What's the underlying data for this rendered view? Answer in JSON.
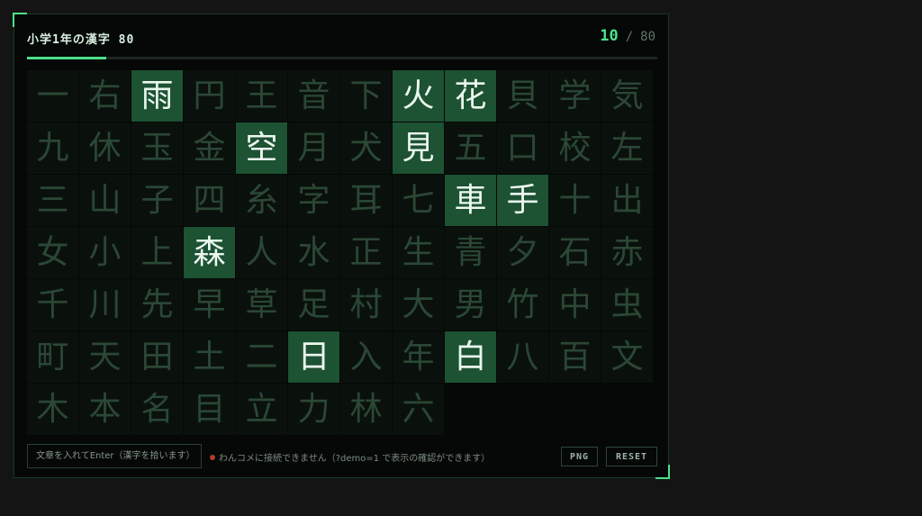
{
  "header": {
    "title": "小学1年の漢字 80",
    "count_current": "10",
    "count_separator": "/",
    "count_total": "80"
  },
  "progress": {
    "value": 0.125
  },
  "colors": {
    "accent": "#4ee08a",
    "found_cell": "#1d5233",
    "empty_cell": "#0a110c",
    "status_dot": "#b8392f"
  },
  "grid": {
    "columns": 12,
    "cells": [
      {
        "char": "一",
        "found": false
      },
      {
        "char": "右",
        "found": false
      },
      {
        "char": "雨",
        "found": true
      },
      {
        "char": "円",
        "found": false
      },
      {
        "char": "王",
        "found": false
      },
      {
        "char": "音",
        "found": false
      },
      {
        "char": "下",
        "found": false
      },
      {
        "char": "火",
        "found": true
      },
      {
        "char": "花",
        "found": true
      },
      {
        "char": "貝",
        "found": false
      },
      {
        "char": "学",
        "found": false
      },
      {
        "char": "気",
        "found": false
      },
      {
        "char": "九",
        "found": false
      },
      {
        "char": "休",
        "found": false
      },
      {
        "char": "玉",
        "found": false
      },
      {
        "char": "金",
        "found": false
      },
      {
        "char": "空",
        "found": true
      },
      {
        "char": "月",
        "found": false
      },
      {
        "char": "犬",
        "found": false
      },
      {
        "char": "見",
        "found": true
      },
      {
        "char": "五",
        "found": false
      },
      {
        "char": "口",
        "found": false
      },
      {
        "char": "校",
        "found": false
      },
      {
        "char": "左",
        "found": false
      },
      {
        "char": "三",
        "found": false
      },
      {
        "char": "山",
        "found": false
      },
      {
        "char": "子",
        "found": false
      },
      {
        "char": "四",
        "found": false
      },
      {
        "char": "糸",
        "found": false
      },
      {
        "char": "字",
        "found": false
      },
      {
        "char": "耳",
        "found": false
      },
      {
        "char": "七",
        "found": false
      },
      {
        "char": "車",
        "found": true
      },
      {
        "char": "手",
        "found": true
      },
      {
        "char": "十",
        "found": false
      },
      {
        "char": "出",
        "found": false
      },
      {
        "char": "女",
        "found": false
      },
      {
        "char": "小",
        "found": false
      },
      {
        "char": "上",
        "found": false
      },
      {
        "char": "森",
        "found": true
      },
      {
        "char": "人",
        "found": false
      },
      {
        "char": "水",
        "found": false
      },
      {
        "char": "正",
        "found": false
      },
      {
        "char": "生",
        "found": false
      },
      {
        "char": "青",
        "found": false
      },
      {
        "char": "夕",
        "found": false
      },
      {
        "char": "石",
        "found": false
      },
      {
        "char": "赤",
        "found": false
      },
      {
        "char": "千",
        "found": false
      },
      {
        "char": "川",
        "found": false
      },
      {
        "char": "先",
        "found": false
      },
      {
        "char": "早",
        "found": false
      },
      {
        "char": "草",
        "found": false
      },
      {
        "char": "足",
        "found": false
      },
      {
        "char": "村",
        "found": false
      },
      {
        "char": "大",
        "found": false
      },
      {
        "char": "男",
        "found": false
      },
      {
        "char": "竹",
        "found": false
      },
      {
        "char": "中",
        "found": false
      },
      {
        "char": "虫",
        "found": false
      },
      {
        "char": "町",
        "found": false
      },
      {
        "char": "天",
        "found": false
      },
      {
        "char": "田",
        "found": false
      },
      {
        "char": "土",
        "found": false
      },
      {
        "char": "二",
        "found": false
      },
      {
        "char": "日",
        "found": true
      },
      {
        "char": "入",
        "found": false
      },
      {
        "char": "年",
        "found": false
      },
      {
        "char": "白",
        "found": true
      },
      {
        "char": "八",
        "found": false
      },
      {
        "char": "百",
        "found": false
      },
      {
        "char": "文",
        "found": false
      },
      {
        "char": "木",
        "found": false
      },
      {
        "char": "本",
        "found": false
      },
      {
        "char": "名",
        "found": false
      },
      {
        "char": "目",
        "found": false
      },
      {
        "char": "立",
        "found": false
      },
      {
        "char": "力",
        "found": false
      },
      {
        "char": "林",
        "found": false
      },
      {
        "char": "六",
        "found": false
      }
    ]
  },
  "footer": {
    "input_placeholder": "文章を入れてEnter（漢字を拾います）",
    "input_value": "",
    "status_text": "わんコメに接続できません（?demo=1 で表示の確認ができます）",
    "png_label": "PNG",
    "reset_label": "RESET"
  }
}
